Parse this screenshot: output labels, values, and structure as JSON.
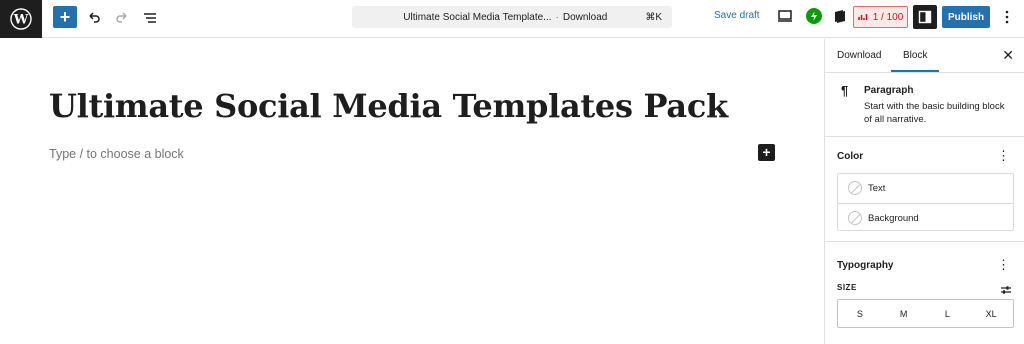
{
  "topbar": {
    "logo": "wordpress-logo",
    "command_center": {
      "title": "Ultimate Social Media Template...",
      "separator": "·",
      "post_type": "Download",
      "shortcut": "⌘K"
    },
    "save_draft": "Save draft",
    "seo_score": "1 / 100",
    "publish": "Publish",
    "accent_color": "#2271b1"
  },
  "editor": {
    "title": "Ultimate Social Media Templates Pack",
    "placeholder": "Type / to choose a block"
  },
  "sidebar": {
    "tabs": [
      {
        "label": "Download"
      },
      {
        "label": "Block"
      }
    ],
    "active_tab": "Block",
    "block": {
      "name": "Paragraph",
      "description": "Start with the basic building block of all narrative."
    },
    "color": {
      "title": "Color",
      "items": [
        {
          "label": "Text"
        },
        {
          "label": "Background"
        }
      ]
    },
    "typography": {
      "title": "Typography",
      "size_label": "SIZE",
      "sizes": [
        "S",
        "M",
        "L",
        "XL"
      ]
    }
  }
}
